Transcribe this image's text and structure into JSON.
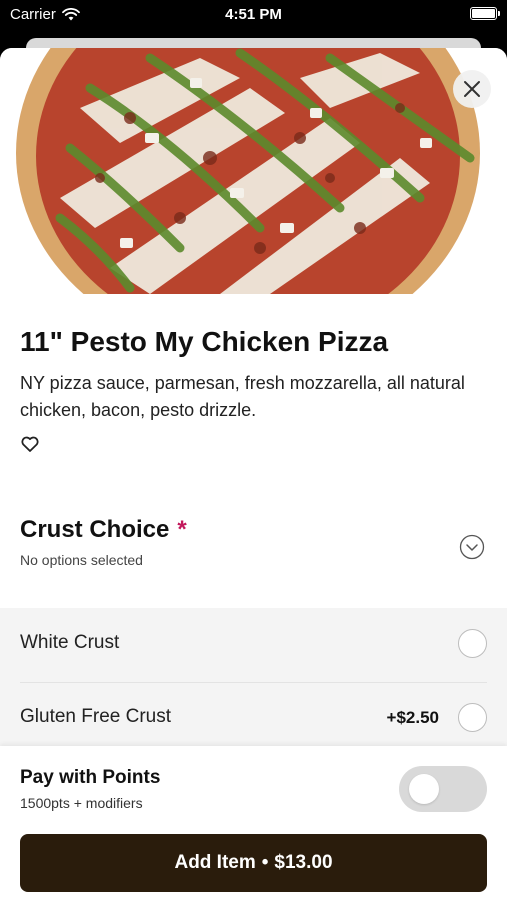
{
  "status_bar": {
    "carrier": "Carrier",
    "time": "4:51 PM"
  },
  "product": {
    "title": "11\" Pesto My Chicken Pizza",
    "description": "NY pizza sauce, parmesan, fresh mozzarella, all natural chicken, bacon, pesto drizzle."
  },
  "crust": {
    "title": "Crust Choice",
    "required_mark": "*",
    "subtitle": "No options selected",
    "options": [
      {
        "label": "White Crust",
        "price": ""
      },
      {
        "label": "Gluten Free Crust",
        "price": "+$2.50"
      }
    ]
  },
  "points": {
    "title": "Pay with Points",
    "subtitle": "1500pts + modifiers",
    "enabled": false
  },
  "add_button": {
    "label": "Add Item",
    "separator": "•",
    "price": "$13.00"
  },
  "colors": {
    "accent_required": "#c2185b",
    "add_button_bg": "#2a1c0c",
    "option_bg": "#f4f4f4"
  },
  "icons": [
    "wifi-icon",
    "battery-icon",
    "close-icon",
    "heart-icon",
    "chevron-down-icon"
  ]
}
